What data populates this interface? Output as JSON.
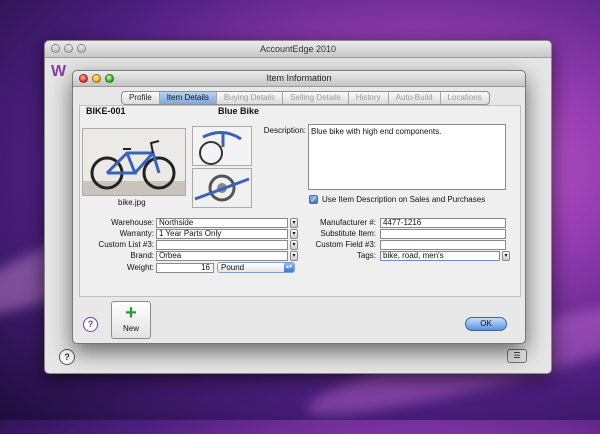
{
  "back_window": {
    "title": "AccountEdge 2010",
    "logo": "W"
  },
  "window": {
    "title": "Item Information"
  },
  "tabs": [
    {
      "label": "Profile",
      "enabled": true,
      "active": false
    },
    {
      "label": "Item Details",
      "enabled": true,
      "active": true
    },
    {
      "label": "Buying Details",
      "enabled": false,
      "active": false
    },
    {
      "label": "Selling Details",
      "enabled": false,
      "active": false
    },
    {
      "label": "History",
      "enabled": false,
      "active": false
    },
    {
      "label": "Auto-Build",
      "enabled": false,
      "active": false
    },
    {
      "label": "Locations",
      "enabled": false,
      "active": false
    }
  ],
  "item": {
    "number": "BIKE-001",
    "name": "Blue Bike",
    "image_filename": "bike.jpg"
  },
  "description": {
    "label": "Description:",
    "value": "Blue bike with high end components."
  },
  "use_description": {
    "label": "Use Item Description on Sales and Purchases",
    "checked": true
  },
  "left_fields": {
    "warehouse": {
      "label": "Warehouse:",
      "value": "Northside"
    },
    "warranty": {
      "label": "Warranty:",
      "value": "1 Year Parts Only"
    },
    "custom_list_3": {
      "label": "Custom List #3:",
      "value": ""
    },
    "brand": {
      "label": "Brand:",
      "value": "Orbea"
    },
    "weight": {
      "label": "Weight:",
      "value": "16",
      "unit": "Pound"
    }
  },
  "right_fields": {
    "manufacturer": {
      "label": "Manufacturer #:",
      "value": "4477-1216"
    },
    "substitute_item": {
      "label": "Substitute Item:",
      "value": ""
    },
    "custom_field_3": {
      "label": "Custom Field #3:",
      "value": ""
    },
    "tags": {
      "label": "Tags:",
      "value": "bike, road, men's"
    }
  },
  "buttons": {
    "new": "New",
    "ok": "OK",
    "help": "?"
  },
  "colors": {
    "accent": "#5a92dd",
    "bike_blue": "#3a62b8"
  }
}
